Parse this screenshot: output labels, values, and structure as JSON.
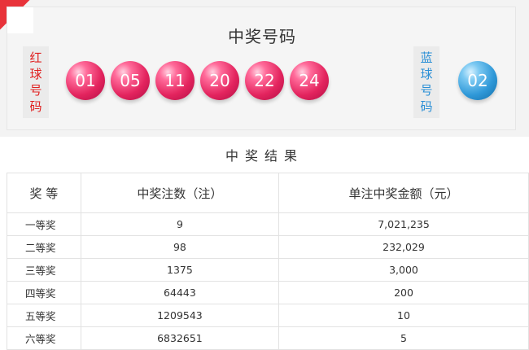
{
  "header": {
    "title": "中奖号码"
  },
  "red_label": [
    "红",
    "球",
    "号",
    "码"
  ],
  "blue_label": [
    "蓝",
    "球",
    "号",
    "码"
  ],
  "red_balls": [
    "01",
    "05",
    "11",
    "20",
    "22",
    "24"
  ],
  "blue_balls": [
    "02"
  ],
  "colors": {
    "red_ball": "#e3245e",
    "blue_ball": "#2f98d8",
    "red_text": "#e02020",
    "blue_text": "#2a8fd6"
  },
  "results": {
    "title": "中奖结果",
    "headers": [
      "奖 等",
      "中奖注数（注）",
      "单注中奖金额（元）"
    ],
    "rows": [
      {
        "level": "一等奖",
        "count": "9",
        "amount": "7,021,235"
      },
      {
        "level": "二等奖",
        "count": "98",
        "amount": "232,029"
      },
      {
        "level": "三等奖",
        "count": "1375",
        "amount": "3,000"
      },
      {
        "level": "四等奖",
        "count": "64443",
        "amount": "200"
      },
      {
        "level": "五等奖",
        "count": "1209543",
        "amount": "10"
      },
      {
        "level": "六等奖",
        "count": "6832651",
        "amount": "5"
      }
    ]
  }
}
